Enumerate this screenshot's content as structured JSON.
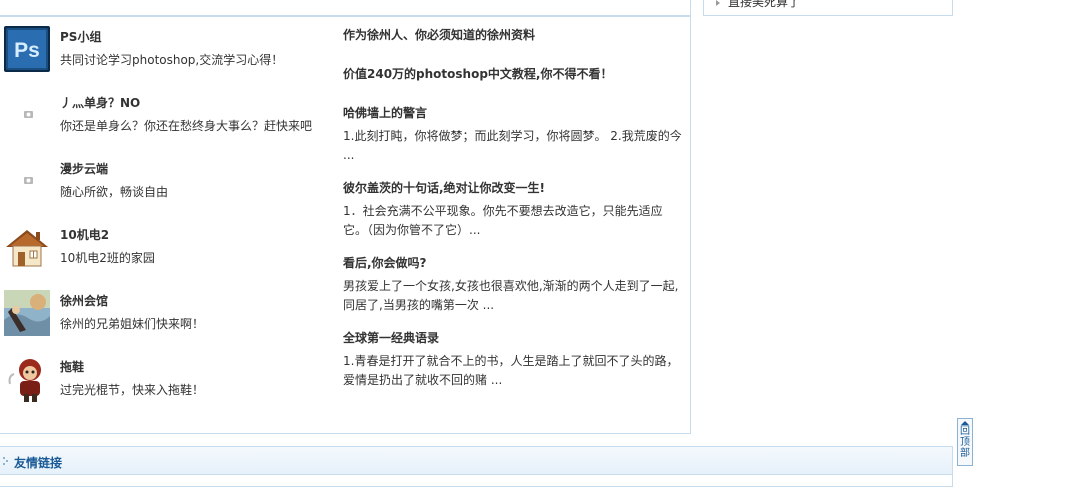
{
  "sidebar": {
    "item_label": "直接美死算了"
  },
  "groups": [
    {
      "name": "PS小组",
      "desc": "共同讨论学习photoshop,交流学习心得！",
      "icon": "photoshop-logo-icon"
    },
    {
      "name": "丿灬单身？NO",
      "desc": "你还是单身么？你还在愁终身大事么？赶快来吧",
      "icon": "placeholder-image-icon"
    },
    {
      "name": "漫步云端",
      "desc": "随心所欲，畅谈自由",
      "icon": "placeholder-image-icon"
    },
    {
      "name": "10机电2",
      "desc": "10机电2班的家园",
      "icon": "house-icon"
    },
    {
      "name": "徐州会馆",
      "desc": "徐州的兄弟姐妹们快来啊！",
      "icon": "painting-thumbnail-icon"
    },
    {
      "name": "拖鞋",
      "desc": "过完光棍节，快来入拖鞋！",
      "icon": "cartoon-character-icon"
    }
  ],
  "articles": [
    {
      "title": "作为徐州人、你必须知道的徐州资料",
      "summary": ""
    },
    {
      "title": "价值240万的photoshop中文教程,你不得不看！",
      "summary": ""
    },
    {
      "title": "哈佛墙上的警言",
      "summary": "1.此刻打盹，你将做梦；而此刻学习，你将圆梦。 2.我荒废的今 ..."
    },
    {
      "title": "彼尔盖茨的十句话,绝对让你改变一生!",
      "summary": "1．社会充满不公平现象。你先不要想去改造它，只能先适应它。（因为你管不了它）..."
    },
    {
      "title": "看后,你会做吗?",
      "summary": "男孩爱上了一个女孩,女孩也很喜欢他,渐渐的两个人走到了一起,同居了,当男孩的嘴第一次 ..."
    },
    {
      "title": "全球第一经典语录",
      "summary": "1.青春是打开了就合不上的书，人生是踏上了就回不了头的路，爱情是扔出了就收不回的赌 ..."
    }
  ],
  "links": {
    "title": "友情链接"
  },
  "back_to_top": {
    "label": "回顶部"
  },
  "colors": {
    "border": "#c7dcec",
    "link_title": "#1a5a96",
    "text": "#333333"
  }
}
